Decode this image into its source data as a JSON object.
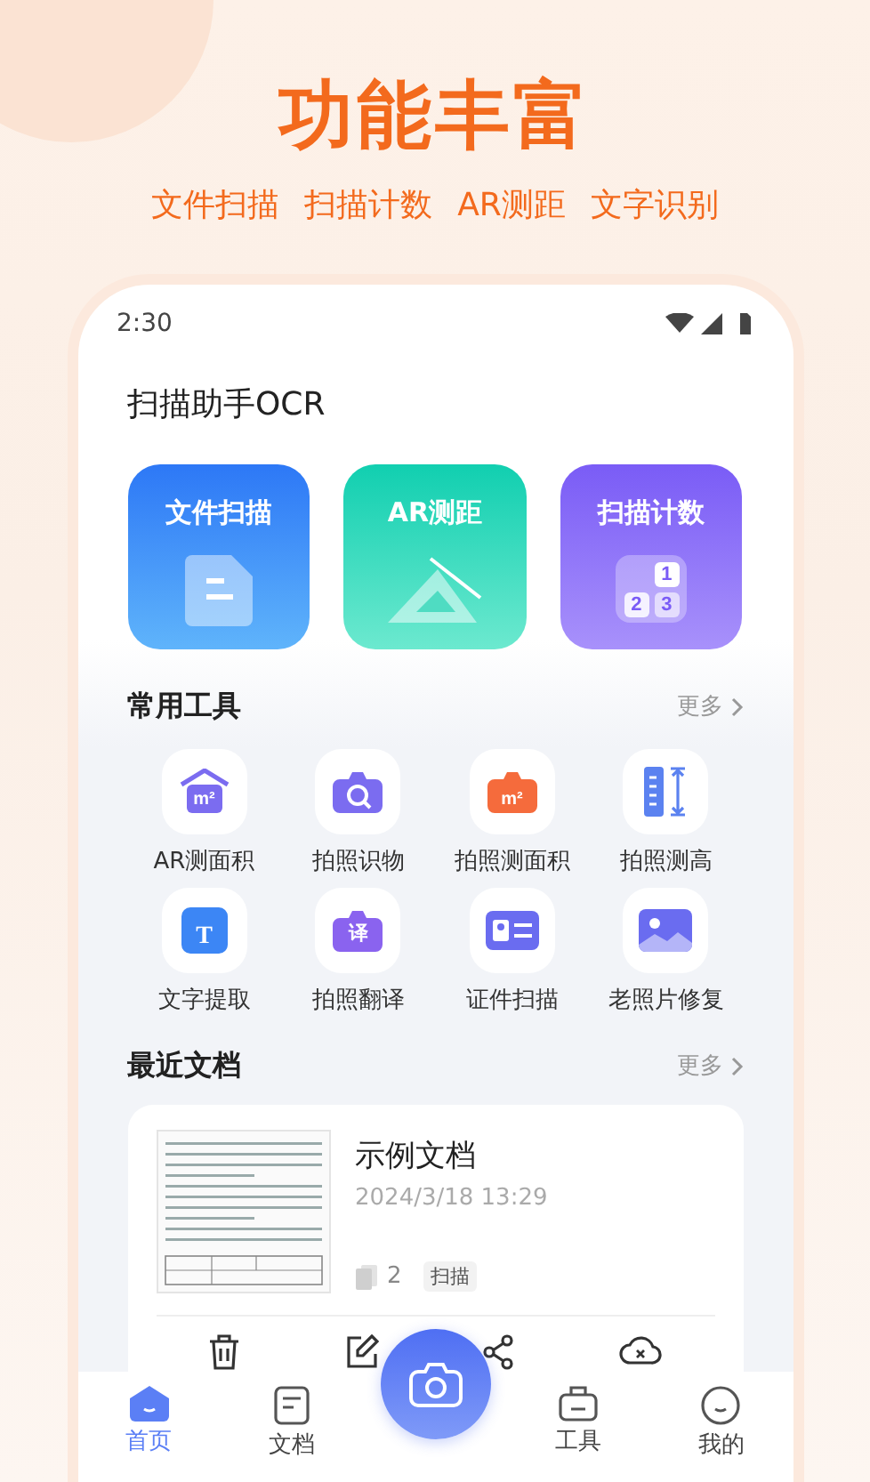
{
  "headline": "功能丰富",
  "features": [
    "文件扫描",
    "扫描计数",
    "AR测距",
    "文字识别"
  ],
  "status_bar": {
    "time": "2:30"
  },
  "app_title": "扫描助手OCR",
  "quick_actions": [
    {
      "label": "文件扫描",
      "kind": "document"
    },
    {
      "label": "AR测距",
      "kind": "ruler"
    },
    {
      "label": "扫描计数",
      "kind": "counter",
      "digits": [
        "1",
        "2",
        "3"
      ]
    }
  ],
  "tools_section": {
    "title": "常用工具",
    "more": "更多"
  },
  "tools": [
    {
      "label": "AR测面积",
      "kind": "house",
      "glyph": "m²"
    },
    {
      "label": "拍照识物",
      "kind": "lens"
    },
    {
      "label": "拍照测面积",
      "kind": "area",
      "glyph": "m²"
    },
    {
      "label": "拍照测高",
      "kind": "height"
    },
    {
      "label": "文字提取",
      "kind": "text",
      "glyph": "T"
    },
    {
      "label": "拍照翻译",
      "kind": "translate",
      "glyph": "译"
    },
    {
      "label": "证件扫描",
      "kind": "idcard"
    },
    {
      "label": "老照片修复",
      "kind": "photo"
    }
  ],
  "recent_section": {
    "title": "最近文档",
    "more": "更多"
  },
  "documents": [
    {
      "name": "示例文档",
      "date": "2024/3/18 13:29",
      "pages": "2",
      "tag": "扫描"
    }
  ],
  "nav": [
    {
      "label": "首页",
      "kind": "home",
      "selected": true
    },
    {
      "label": "文档",
      "kind": "docs",
      "selected": false
    },
    {
      "label": "工具",
      "kind": "tools",
      "selected": false
    },
    {
      "label": "我的",
      "kind": "me",
      "selected": false
    }
  ]
}
